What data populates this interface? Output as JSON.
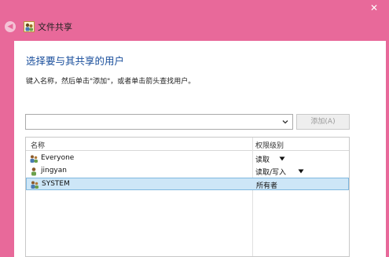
{
  "window": {
    "title": "文件共享",
    "close_glyph": "✕",
    "back_glyph": "◀"
  },
  "main": {
    "heading": "选择要与其共享的用户",
    "instruction": "键入名称，然后单击\"添加\"，或者单击箭头查找用户。",
    "combo_value": "",
    "add_button": "添加(A)"
  },
  "list": {
    "headers": {
      "name": "名称",
      "permission": "权限级别"
    },
    "rows": [
      {
        "name": "Everyone",
        "permission": "读取",
        "has_dropdown": true,
        "icon": "group-icon"
      },
      {
        "name": "jingyan",
        "permission": "读取/写入",
        "has_dropdown": true,
        "icon": "user-icon"
      },
      {
        "name": "SYSTEM",
        "permission": "所有者",
        "has_dropdown": false,
        "icon": "group-icon",
        "selected": true
      }
    ]
  },
  "colors": {
    "titlebar": "#e8699a",
    "heading": "#1a4f9c",
    "selection": "#cde6f7"
  }
}
